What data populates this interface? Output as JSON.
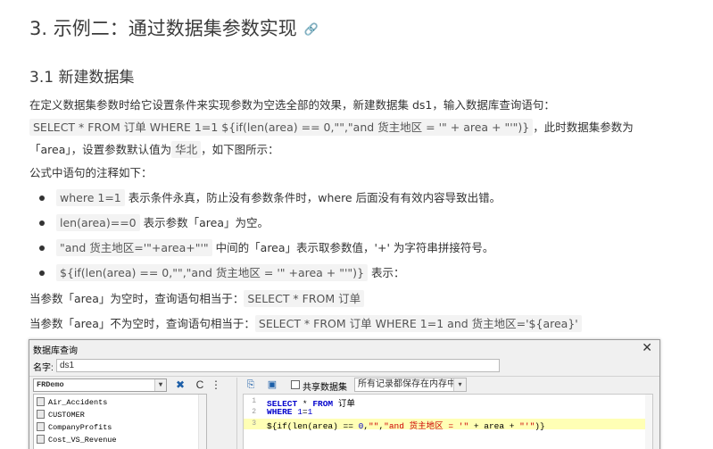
{
  "heading": "3. 示例二：通过数据集参数实现",
  "subheading": "3.1 新建数据集",
  "para1": {
    "text": "在定义数据集参数时给它设置条件来实现参数为空选全部的效果，新建数据集 ds1，输入数据库查询语句：",
    "code": "SELECT * FROM 订单  WHERE 1=1  ${if(len(area) == 0,\"\",\"and 货主地区 = '\" + area + \"'\")}",
    "after_code": "，此时数据集参数为",
    "line3_a": "「area」，设置参数默认值为",
    "default_value": "华北",
    "line3_b": "，如下图所示："
  },
  "comment_intro": "公式中语句的注释如下：",
  "bullets": [
    {
      "code": "where 1=1",
      "text": "表示条件永真，防止没有参数条件时，where 后面没有有效内容导致出错。"
    },
    {
      "code": "len(area)==0",
      "text": "表示参数「area」为空。"
    },
    {
      "code": "\"and 货主地区='\"+area+\"'\"",
      "text": "中间的「area」表示取参数值，'+' 为字符串拼接符号。"
    },
    {
      "code": "${if(len(area) == 0,\"\",\"and 货主地区 = '\" +area + \"'\")}",
      "text": "表示："
    }
  ],
  "empty_case": {
    "text": "当参数「area」为空时，查询语句相当于：",
    "code": "SELECT * FROM 订单"
  },
  "nonempty_case": {
    "text": "当参数「area」不为空时，查询语句相当于：",
    "code": "SELECT * FROM 订单 WHERE 1=1 and 货主地区='${area}'"
  },
  "dialog": {
    "title": "数据库查询",
    "close": "✕",
    "name_label": "名字:",
    "name_value": "ds1",
    "datasource": "FRDemo",
    "tables": [
      "Air_Accidents",
      "CUSTOMER",
      "CompanyProfits",
      "Cost_VS_Revenue"
    ],
    "share_label": "共享数据集",
    "memory_option": "所有记录都保存在内存中",
    "sql_lines": [
      {
        "num": "1",
        "parts": [
          {
            "t": "SELECT",
            "c": "kw"
          },
          {
            "t": " * ",
            "c": "plain"
          },
          {
            "t": "FROM",
            "c": "kw"
          },
          {
            "t": " 订单",
            "c": "plain"
          }
        ]
      },
      {
        "num": "2",
        "parts": [
          {
            "t": "WHERE",
            "c": "kw"
          },
          {
            "t": " ",
            "c": "plain"
          },
          {
            "t": "1",
            "c": "num"
          },
          {
            "t": "=",
            "c": "plain"
          },
          {
            "t": "1",
            "c": "num"
          }
        ]
      },
      {
        "num": "3",
        "parts": [
          {
            "t": "${if(len(area) == ",
            "c": "plain"
          },
          {
            "t": "0",
            "c": "num"
          },
          {
            "t": ",",
            "c": "plain"
          },
          {
            "t": "\"\"",
            "c": "str"
          },
          {
            "t": ",",
            "c": "plain"
          },
          {
            "t": "\"and 货主地区 = '\"",
            "c": "str"
          },
          {
            "t": " + area + ",
            "c": "plain"
          },
          {
            "t": "\"'\"",
            "c": "str"
          },
          {
            "t": ")}",
            "c": "plain"
          }
        ]
      }
    ]
  }
}
